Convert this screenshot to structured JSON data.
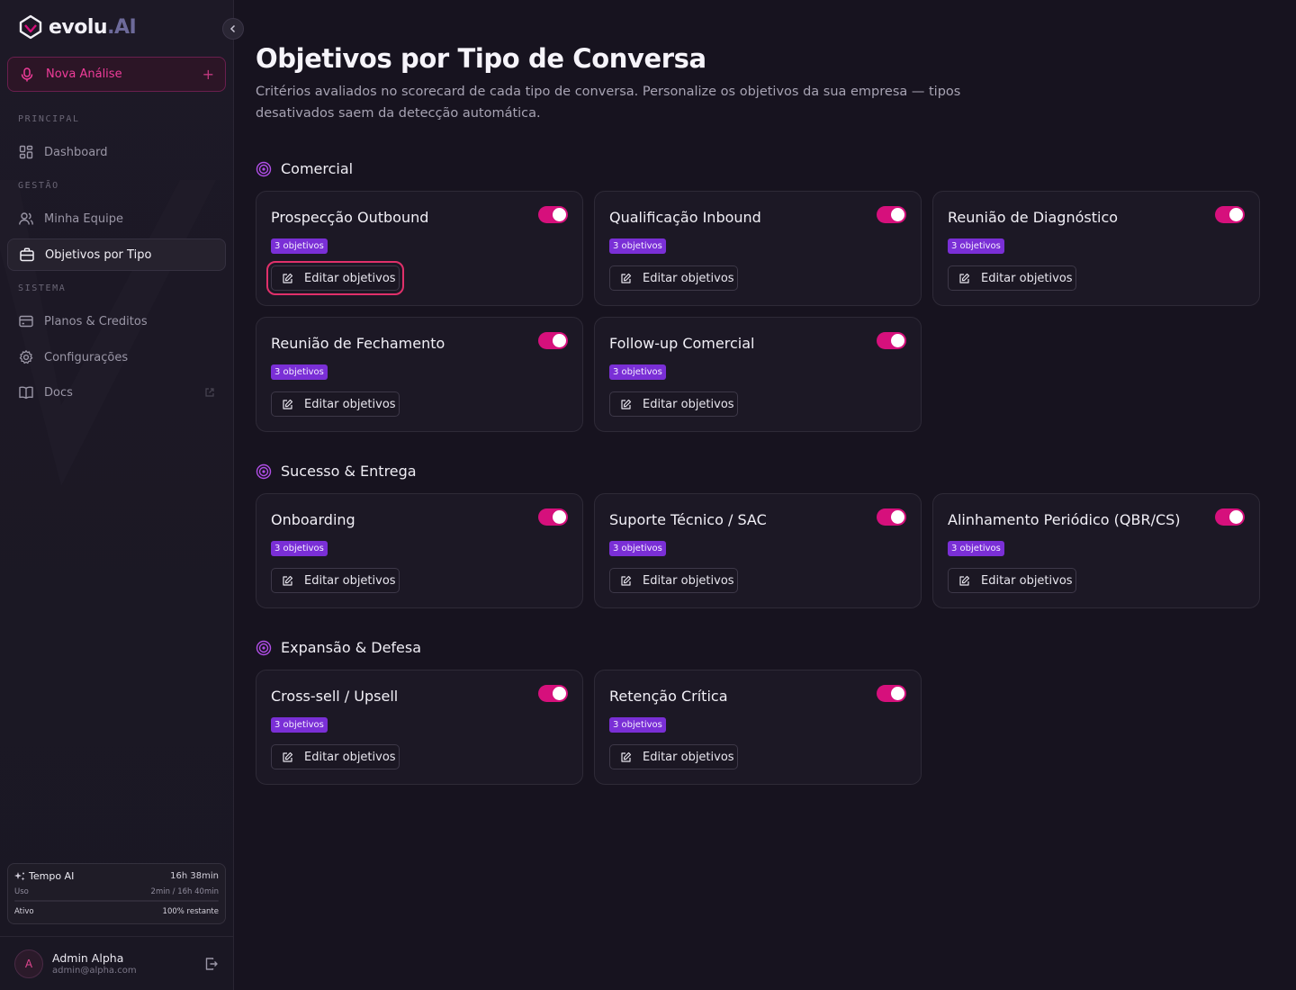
{
  "brand": {
    "name": "evolu",
    "suffix": ".AI"
  },
  "sidebar": {
    "new_analysis": "Nova Análise",
    "sections": {
      "principal": "PRINCIPAL",
      "gestao": "GESTÃO",
      "sistema": "SISTEMA"
    },
    "items": [
      {
        "label": "Dashboard",
        "icon": "dashboard-icon"
      },
      {
        "label": "Minha Equipe",
        "icon": "users-icon"
      },
      {
        "label": "Objetivos por Tipo",
        "icon": "briefcase-icon",
        "active": true
      },
      {
        "label": "Planos & Creditos",
        "icon": "credit-card-icon"
      },
      {
        "label": "Configurações",
        "icon": "gear-icon"
      },
      {
        "label": "Docs",
        "icon": "book-icon"
      }
    ],
    "tempo": {
      "title": "Tempo AI",
      "total": "16h 38min",
      "uso_label": "Uso",
      "uso_value": "2min / 16h 40min",
      "ativo_label": "Ativo",
      "ativo_value": "100% restante"
    },
    "user": {
      "initial": "A",
      "name": "Admin Alpha",
      "email": "admin@alpha.com"
    }
  },
  "main": {
    "title": "Objetivos por Tipo de Conversa",
    "description": "Critérios avaliados no scorecard de cada tipo de conversa. Personalize os objetivos da sua empresa — tipos desativados saem da detecção automática.",
    "edit_label": "Editar objetivos",
    "groups": [
      {
        "title": "Comercial",
        "cards": [
          {
            "title": "Prospecção Outbound",
            "badge": "3 objetivos",
            "enabled": true
          },
          {
            "title": "Qualificação Inbound",
            "badge": "3 objetivos",
            "enabled": true
          },
          {
            "title": "Reunião de Diagnóstico",
            "badge": "3 objetivos",
            "enabled": true
          },
          {
            "title": "Reunião de Fechamento",
            "badge": "3 objetivos",
            "enabled": true
          },
          {
            "title": "Follow-up Comercial",
            "badge": "3 objetivos",
            "enabled": true
          }
        ]
      },
      {
        "title": "Sucesso & Entrega",
        "cards": [
          {
            "title": "Onboarding",
            "badge": "3 objetivos",
            "enabled": true
          },
          {
            "title": "Suporte Técnico / SAC",
            "badge": "3 objetivos",
            "enabled": true
          },
          {
            "title": "Alinhamento Periódico (QBR/CS)",
            "badge": "3 objetivos",
            "enabled": true
          }
        ]
      },
      {
        "title": "Expansão & Defesa",
        "cards": [
          {
            "title": "Cross-sell / Upsell",
            "badge": "3 objetivos",
            "enabled": true
          },
          {
            "title": "Retenção Crítica",
            "badge": "3 objetivos",
            "enabled": true
          }
        ]
      }
    ]
  },
  "colors": {
    "accent": "#d6107c",
    "badge": "#7a2fd6",
    "background": "#17131f"
  }
}
